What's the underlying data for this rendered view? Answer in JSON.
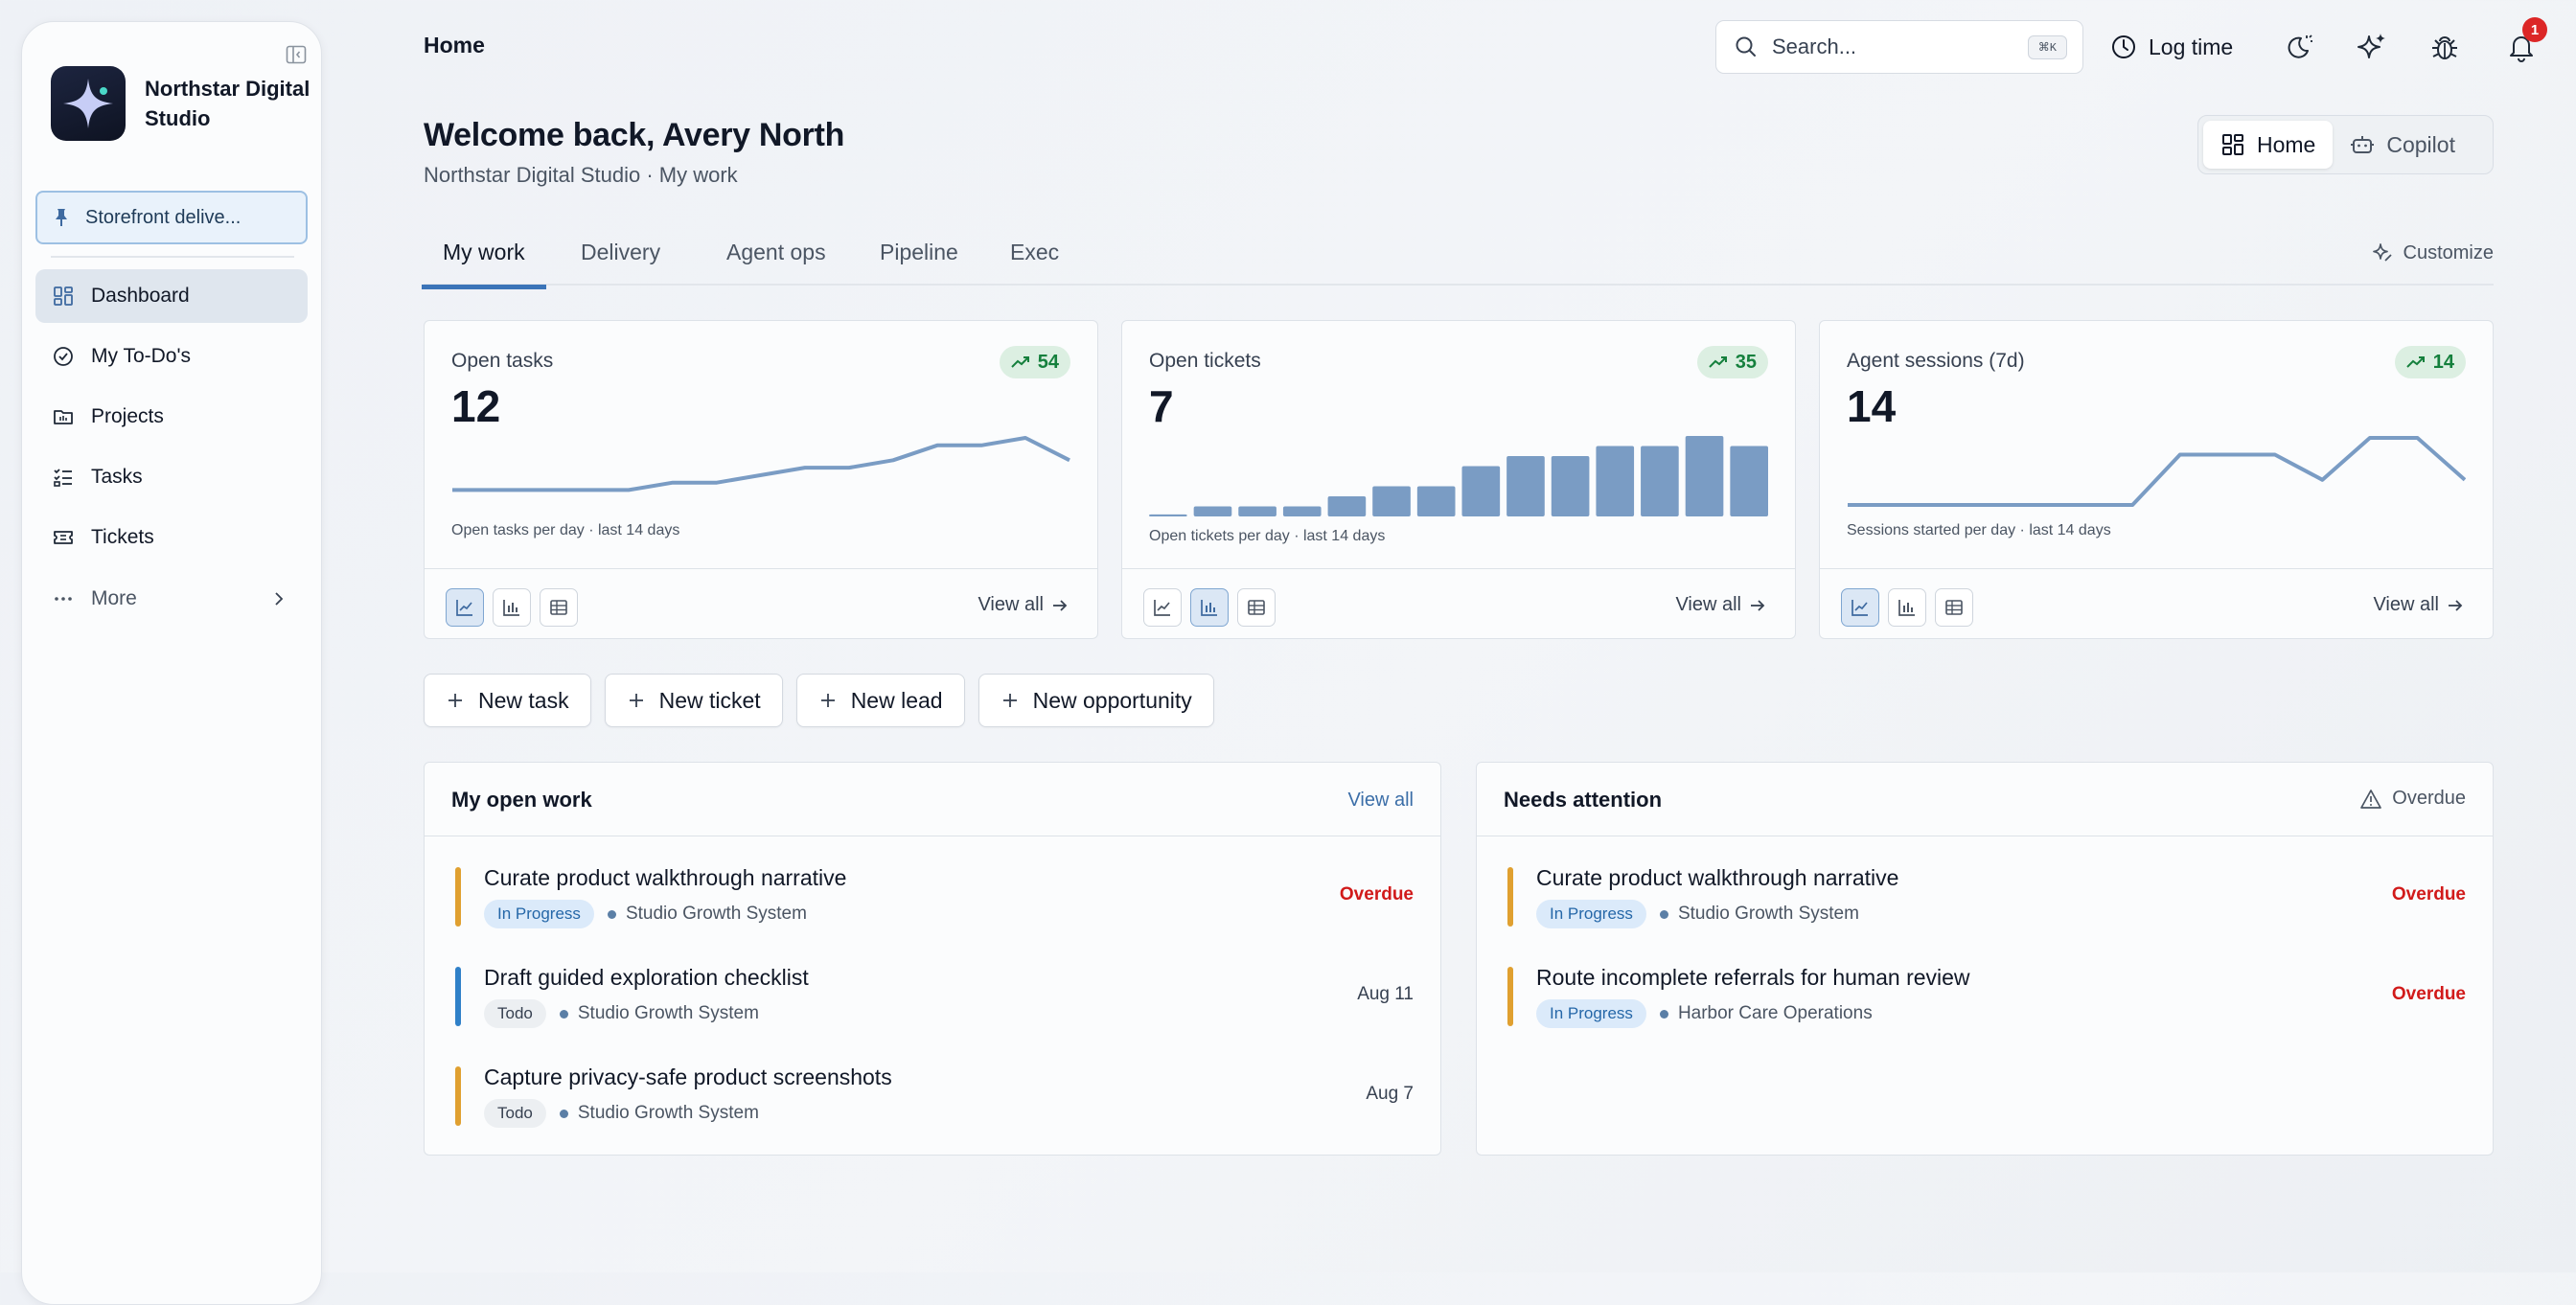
{
  "sidebar": {
    "brand_name": "Northstar Digital Studio",
    "pinned": "Storefront delive...",
    "nav": [
      {
        "label": "Dashboard",
        "icon": "dashboard-icon",
        "active": true
      },
      {
        "label": "My To-Do's",
        "icon": "check-circle-icon",
        "active": false
      },
      {
        "label": "Projects",
        "icon": "folder-icon",
        "active": false
      },
      {
        "label": "Tasks",
        "icon": "task-list-icon",
        "active": false
      },
      {
        "label": "Tickets",
        "icon": "ticket-icon",
        "active": false
      }
    ],
    "more_label": "More"
  },
  "topbar": {
    "breadcrumb": "Home",
    "search_placeholder": "Search...",
    "search_shortcut": "⌘K",
    "log_time": "Log time",
    "notification_count": "1"
  },
  "header": {
    "welcome": "Welcome back, Avery North",
    "subtitle": "Northstar Digital Studio · My work",
    "modes": [
      {
        "label": "Home",
        "active": true
      },
      {
        "label": "Copilot",
        "active": false
      }
    ]
  },
  "tabs": {
    "items": [
      "My work",
      "Delivery",
      "Agent ops",
      "Pipeline",
      "Exec"
    ],
    "active": "My work",
    "customize": "Customize"
  },
  "stats": [
    {
      "title": "Open tasks",
      "value": "12",
      "trend": "54",
      "caption": "Open tasks per day · last 14 days",
      "view_all": "View all",
      "chart_type": "line",
      "series": [
        2,
        2,
        2,
        2,
        2,
        3,
        3,
        4,
        5,
        5,
        6,
        8,
        8,
        9,
        6
      ]
    },
    {
      "title": "Open tickets",
      "value": "7",
      "trend": "35",
      "caption": "Open tickets per day · last 14 days",
      "view_all": "View all",
      "chart_type": "bar",
      "series": [
        0.2,
        1,
        1,
        1,
        2,
        3,
        3,
        5,
        6,
        6,
        7,
        7,
        8,
        7
      ]
    },
    {
      "title": "Agent sessions (7d)",
      "value": "14",
      "trend": "14",
      "caption": "Sessions started per day · last 14 days",
      "view_all": "View all",
      "chart_type": "line",
      "series": [
        0,
        0,
        0,
        0,
        0,
        0,
        0,
        3,
        3,
        3,
        1.5,
        4,
        4,
        1.5
      ]
    }
  ],
  "actions": [
    "New task",
    "New ticket",
    "New lead",
    "New opportunity"
  ],
  "my_open_work": {
    "title": "My open work",
    "link": "View all",
    "items": [
      {
        "title": "Curate product walkthrough narrative",
        "status": "In Progress",
        "project": "Studio Growth System",
        "date": "Overdue",
        "overdue": true,
        "color": "#e0a030"
      },
      {
        "title": "Draft guided exploration checklist",
        "status": "Todo",
        "project": "Studio Growth System",
        "date": "Aug 11",
        "overdue": false,
        "color": "#2f80c8"
      },
      {
        "title": "Capture privacy-safe product screenshots",
        "status": "Todo",
        "project": "Studio Growth System",
        "date": "Aug 7",
        "overdue": false,
        "color": "#e0a030"
      }
    ]
  },
  "needs_attention": {
    "title": "Needs attention",
    "filter": "Overdue",
    "items": [
      {
        "title": "Curate product walkthrough narrative",
        "status": "In Progress",
        "project": "Studio Growth System",
        "date": "Overdue",
        "overdue": true,
        "color": "#e0a030"
      },
      {
        "title": "Route incomplete referrals for human review",
        "status": "In Progress",
        "project": "Harbor Care Operations",
        "date": "Overdue",
        "overdue": true,
        "color": "#e0a030"
      }
    ]
  },
  "colors": {
    "accent": "#3b74b8",
    "chart": "#7a9cc4",
    "overdue": "#d11a1a",
    "trend_up": "#15803d"
  }
}
